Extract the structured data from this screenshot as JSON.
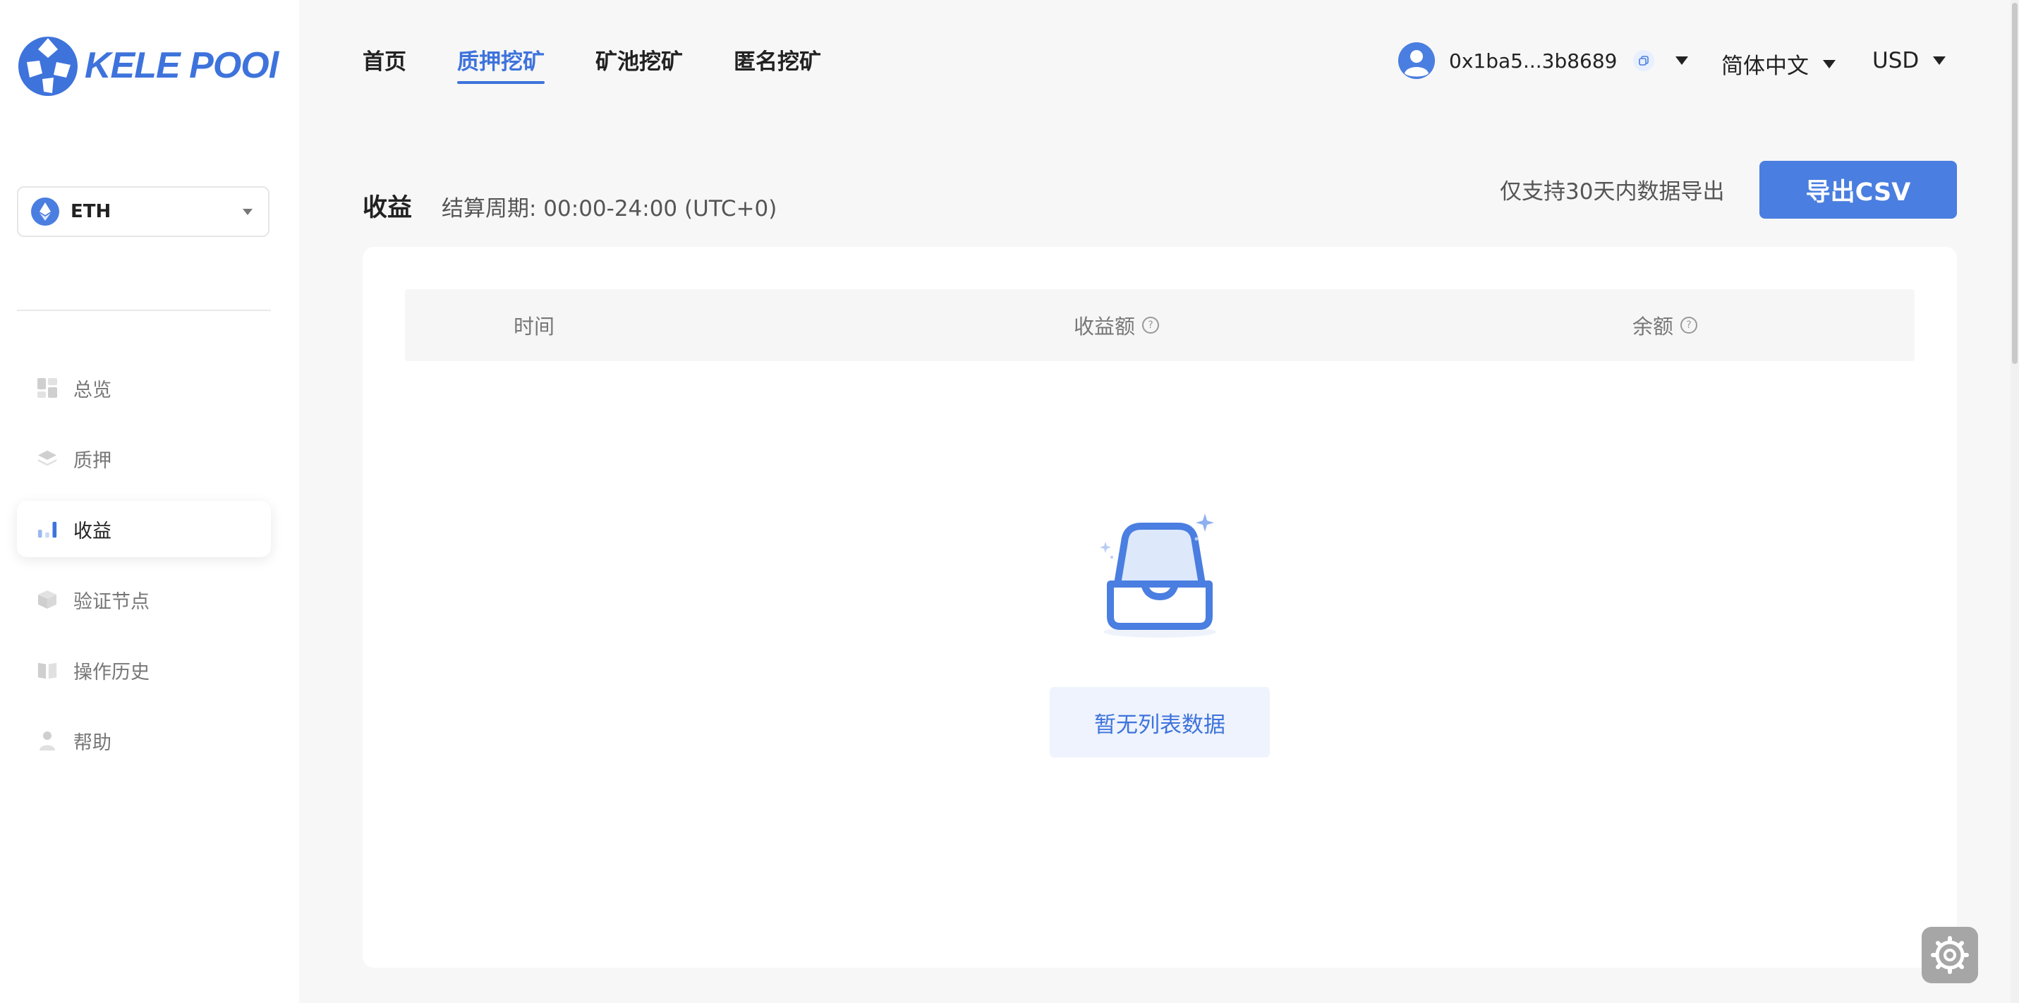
{
  "brand": {
    "name": "KELE POOl",
    "color": "#3e73dc"
  },
  "coin_selector": {
    "value": "ETH",
    "icon": "ethereum-icon"
  },
  "sidebar": {
    "items": [
      {
        "label": "总览",
        "icon": "overview-icon",
        "active": false
      },
      {
        "label": "质押",
        "icon": "layers-icon",
        "active": false
      },
      {
        "label": "收益",
        "icon": "bar-chart-icon",
        "active": true
      },
      {
        "label": "验证节点",
        "icon": "cube-icon",
        "active": false
      },
      {
        "label": "操作历史",
        "icon": "book-icon",
        "active": false
      },
      {
        "label": "帮助",
        "icon": "person-icon",
        "active": false
      }
    ]
  },
  "nav": {
    "items": [
      {
        "label": "首页",
        "active": false
      },
      {
        "label": "质押挖矿",
        "active": true
      },
      {
        "label": "矿池挖矿",
        "active": false
      },
      {
        "label": "匿名挖矿",
        "active": false
      }
    ]
  },
  "account": {
    "address": "0x1ba5...3b8689",
    "avatar_icon": "user-avatar-icon",
    "copy_icon": "copy-icon"
  },
  "language": {
    "value": "简体中文"
  },
  "currency": {
    "value": "USD"
  },
  "section": {
    "title": "收益",
    "cycle": "结算周期: 00:00-24:00 (UTC+0)",
    "export_note": "仅支持30天内数据导出",
    "export_label": "导出CSV"
  },
  "table": {
    "columns": [
      {
        "label": "时间",
        "help": false
      },
      {
        "label": "收益额",
        "help": true
      },
      {
        "label": "余额",
        "help": true
      }
    ],
    "rows": [],
    "empty_label": "暂无列表数据",
    "empty_icon": "empty-inbox-icon"
  },
  "colors": {
    "accent": "#4a7ee0",
    "accent_light": "#eef3fd",
    "background": "#f7f7f7"
  }
}
